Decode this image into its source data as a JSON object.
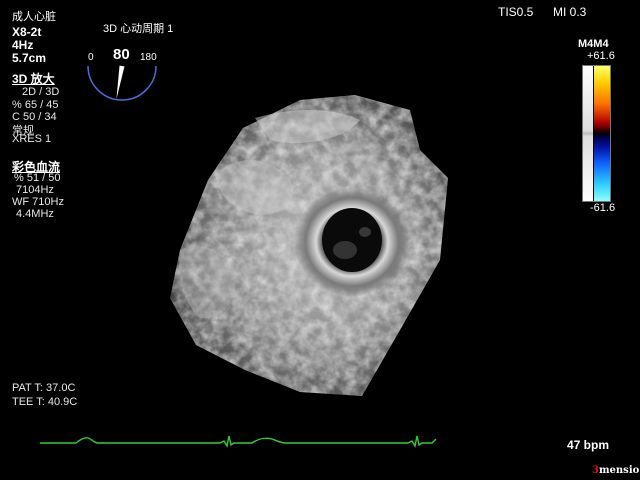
{
  "header": {
    "preset": "成人心脏",
    "probe": "X8-2t",
    "frequency": "4Hz",
    "depth": "5.7cm"
  },
  "zoom3d": {
    "title": "3D 放大",
    "lines": [
      "2D / 3D",
      "% 65 / 45",
      "C  50 / 34",
      "常规",
      "XRES 1"
    ]
  },
  "color_flow": {
    "title": "彩色血流",
    "lines": [
      "% 51 / 50",
      "7104Hz",
      "WF 710Hz",
      "4.4MHz"
    ]
  },
  "cycle": {
    "label": "3D 心动周期 1"
  },
  "angle_gauge": {
    "min_label": "0",
    "value_label": "80",
    "max_label": "180",
    "value": 80,
    "min": 0,
    "max": 180
  },
  "indices": {
    "tis": "TIS0.5",
    "mi": "MI 0.3"
  },
  "color_scale": {
    "map_name": "M4M4",
    "max_label": "+61.6",
    "min_label": "-61.6"
  },
  "temperatures": {
    "patient": "PAT T: 37.0C",
    "tee": "TEE T: 40.9C"
  },
  "ecg": {
    "heart_rate": "47 bpm",
    "color": "#2fd02f"
  },
  "brand": {
    "num": "3",
    "text": "mensio"
  }
}
